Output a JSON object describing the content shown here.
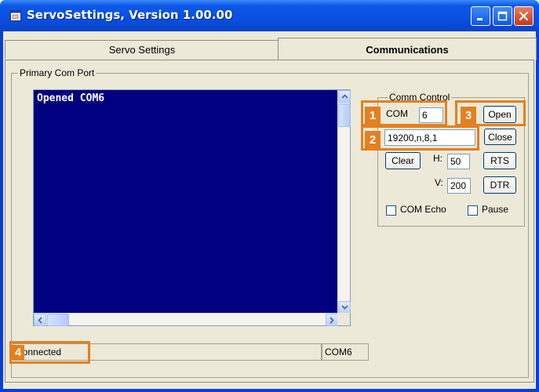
{
  "window": {
    "title": "ServoSettings, Version 1.00.00"
  },
  "tabs": [
    {
      "label": "Servo Settings",
      "active": false
    },
    {
      "label": "Communications",
      "active": true
    }
  ],
  "primary_group": {
    "legend": "Primary Com Port"
  },
  "console": {
    "text": "Opened COM6"
  },
  "comm_control": {
    "legend": "Comm Control",
    "com_label": "COM",
    "com_value": "6",
    "settings_value": "19200,n,8,1",
    "open_label": "Open",
    "close_label": "Close",
    "clear_label": "Clear",
    "h_label": "H:",
    "h_value": "50",
    "v_label": "V:",
    "v_value": "200",
    "rts_label": "RTS",
    "dtr_label": "DTR",
    "com_echo_label": "COM Echo",
    "pause_label": "Pause"
  },
  "status": {
    "connection": "Connected",
    "port": "COM6"
  },
  "callouts": [
    "1",
    "2",
    "3",
    "4"
  ],
  "colors": {
    "highlight": "#e3801f",
    "console_bg": "#010080",
    "titlebar": "#0a4fe0"
  }
}
